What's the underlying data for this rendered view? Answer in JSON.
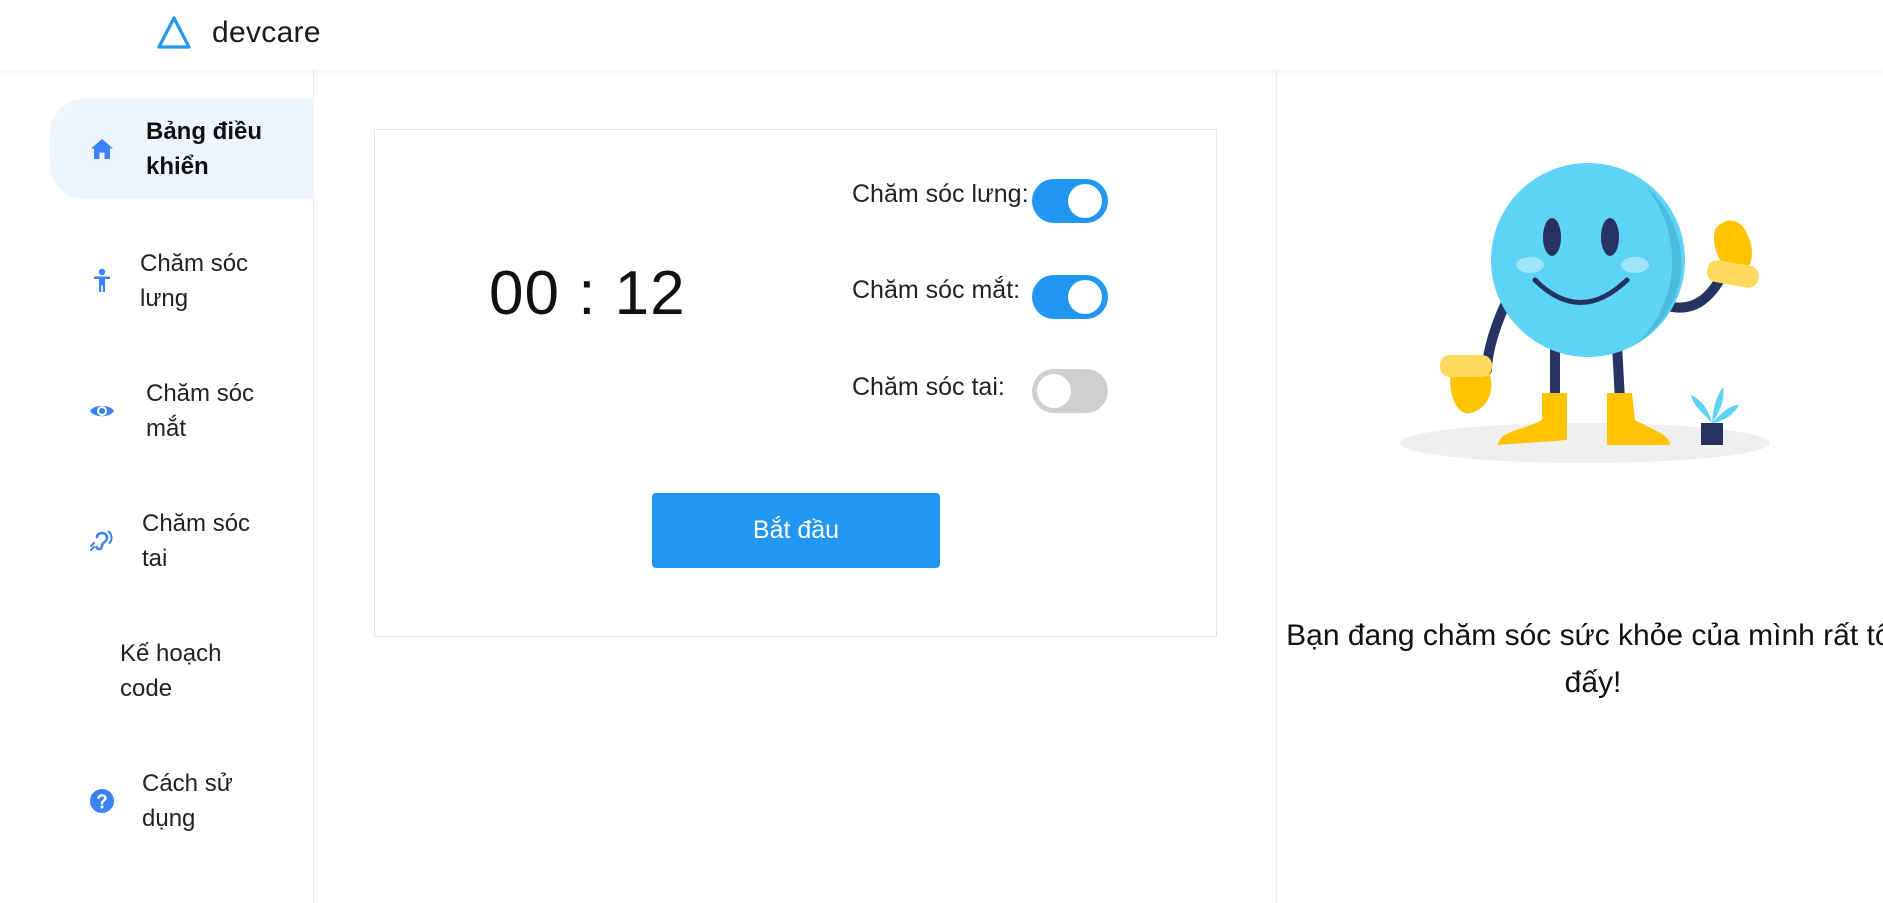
{
  "app": {
    "name": "devcare"
  },
  "sidebar": {
    "items": [
      {
        "label": "Bảng điều khiển",
        "icon": "home-icon",
        "active": true
      },
      {
        "label": "Chăm sóc lưng",
        "icon": "person-icon",
        "active": false
      },
      {
        "label": "Chăm sóc mắt",
        "icon": "eye-icon",
        "active": false
      },
      {
        "label": "Chăm sóc tai",
        "icon": "ear-icon",
        "active": false
      },
      {
        "label": "Kế hoạch code",
        "icon": "",
        "active": false
      },
      {
        "label": "Cách sử dụng",
        "icon": "question-icon",
        "active": false
      }
    ]
  },
  "main": {
    "timer": "00 : 12",
    "toggles": [
      {
        "label": "Chăm sóc lưng:",
        "on": true
      },
      {
        "label": "Chăm sóc mắt:",
        "on": true
      },
      {
        "label": "Chăm sóc tai:",
        "on": false
      }
    ],
    "start_label": "Bắt đầu"
  },
  "right_panel": {
    "message": "Bạn đang chăm sóc sức khỏe của mình rất tốt đấy!",
    "illustration": "smiley-character-illustration"
  },
  "colors": {
    "accent": "#2196f3",
    "active_nav_bg": "#eef5ff",
    "icon_blue": "#3b82f6",
    "toggle_off": "#cfcfcf"
  }
}
